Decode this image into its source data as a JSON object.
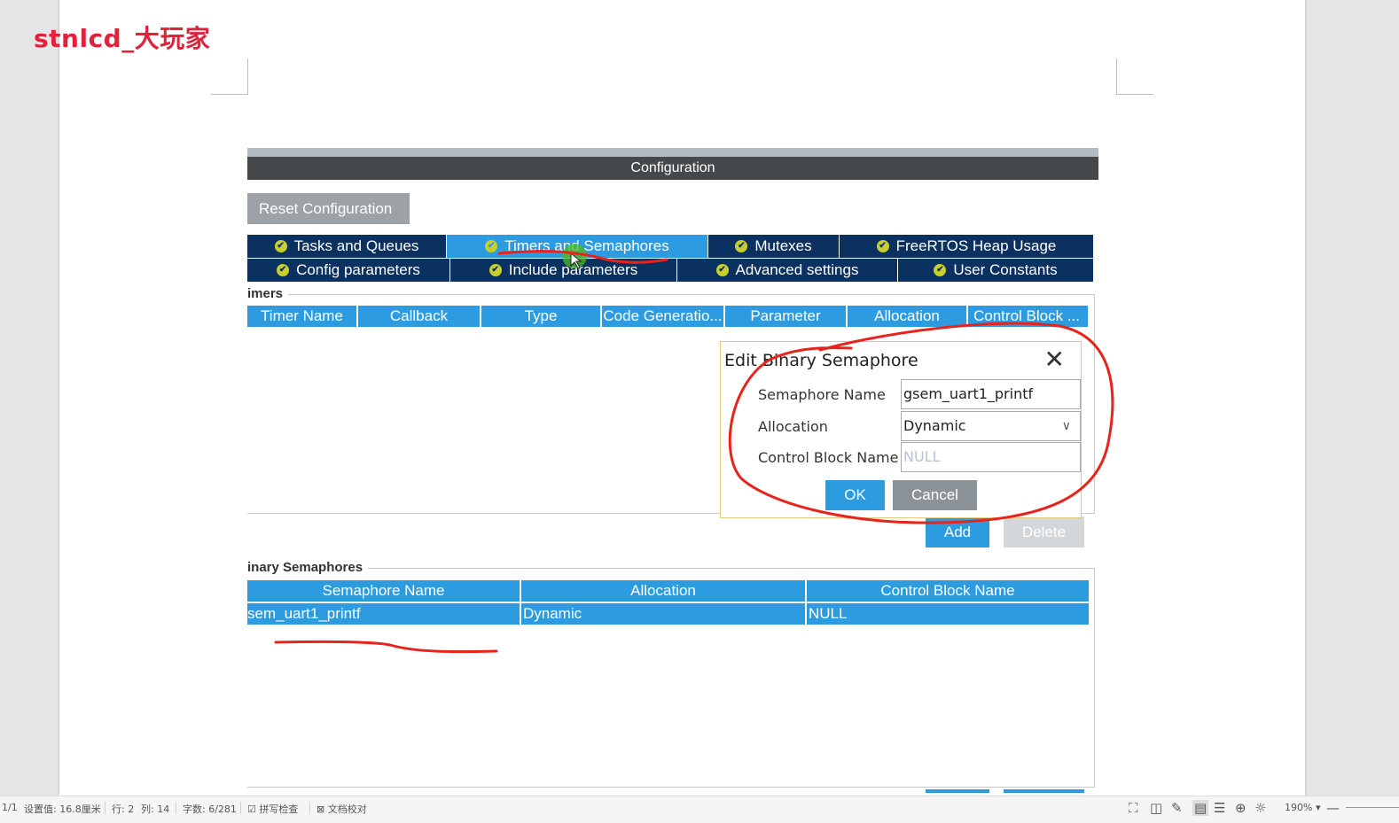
{
  "watermark": "stnlcd_大玩家",
  "config": {
    "title": "Configuration",
    "reset_label": "Reset Configuration",
    "tabs_row1": [
      {
        "label": "Tasks and Queues",
        "active": false
      },
      {
        "label": "Timers and Semaphores",
        "active": true
      },
      {
        "label": "Mutexes",
        "active": false
      },
      {
        "label": "FreeRTOS Heap Usage",
        "active": false
      }
    ],
    "tabs_row2": [
      {
        "label": "Config parameters"
      },
      {
        "label": "Include parameters"
      },
      {
        "label": "Advanced settings"
      },
      {
        "label": "User Constants"
      }
    ]
  },
  "timers": {
    "section_label": "imers",
    "columns": [
      "Timer Name",
      "Callback",
      "Type",
      "Code Generatio...",
      "Parameter",
      "Allocation",
      "Control Block ..."
    ],
    "add_label": "Add",
    "delete_label": "Delete"
  },
  "binary_semaphores": {
    "section_label": "inary Semaphores",
    "columns": [
      "Semaphore Name",
      "Allocation",
      "Control Block Name"
    ],
    "rows": [
      [
        "sem_uart1_printf",
        "Dynamic",
        "NULL"
      ]
    ]
  },
  "dialog": {
    "title": "Edit Binary Semaphore",
    "close_glyph": "✕",
    "name_label": "Semaphore Name",
    "name_value": "gsem_uart1_printf",
    "allocation_label": "Allocation",
    "allocation_value": "Dynamic",
    "cb_label": "Control Block Name",
    "cb_placeholder": "NULL",
    "ok_label": "OK",
    "cancel_label": "Cancel"
  },
  "statusbar": {
    "page": "1/1",
    "setting": "设置值: 16.8厘米",
    "row": "行: 2",
    "col": "列: 14",
    "wordcount": "字数: 6/281",
    "spellcheck": "拼写检查",
    "proofread": "文档校对",
    "zoom": "190%"
  },
  "colors": {
    "accent": "#2d9be0",
    "tab_dark": "#0b3161",
    "annotation": "#e8231c",
    "ok_button": "#2d9be0",
    "cancel_button": "#8b9398"
  }
}
